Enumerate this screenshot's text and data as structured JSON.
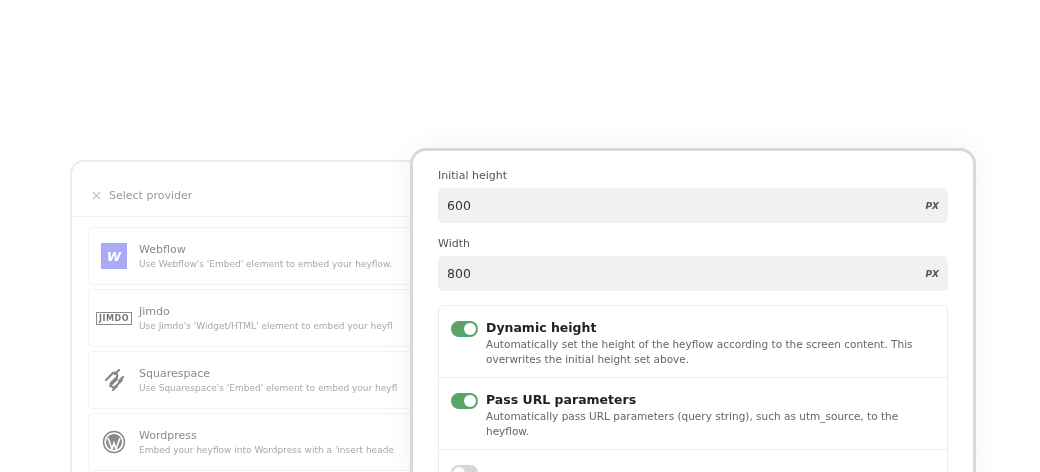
{
  "provider_panel": {
    "title": "Select provider",
    "providers": [
      {
        "kind": "webflow",
        "logo": "W",
        "name": "Webflow",
        "description": "Use Webflow's 'Embed' element to embed your heyflow."
      },
      {
        "kind": "jimdo",
        "logo": "JIMDO",
        "name": "Jimdo",
        "description": "Use Jimdo's 'Widget/HTML' element to embed your heyfl"
      },
      {
        "kind": "squarespace",
        "name": "Squarespace",
        "description": "Use Squarespace's 'Embed' element to embed your heyfl"
      },
      {
        "kind": "wordpress",
        "name": "Wordpress",
        "description": "Embed your heyflow into Wordpress with a 'insert heade"
      }
    ]
  },
  "settings_panel": {
    "fields": [
      {
        "label": "Initial height",
        "value": "600",
        "unit": "PX"
      },
      {
        "label": "Width",
        "value": "800",
        "unit": "PX"
      }
    ],
    "toggles": [
      {
        "title": "Dynamic height",
        "description": "Automatically set the height of the heyflow according to the screen content. This overwrites the initial height set above.",
        "on": true
      },
      {
        "title": "Pass URL parameters",
        "description": "Automatically pass URL parameters (query string), such as utm_source, to the heyflow.",
        "on": true
      },
      {
        "on": false
      }
    ]
  }
}
